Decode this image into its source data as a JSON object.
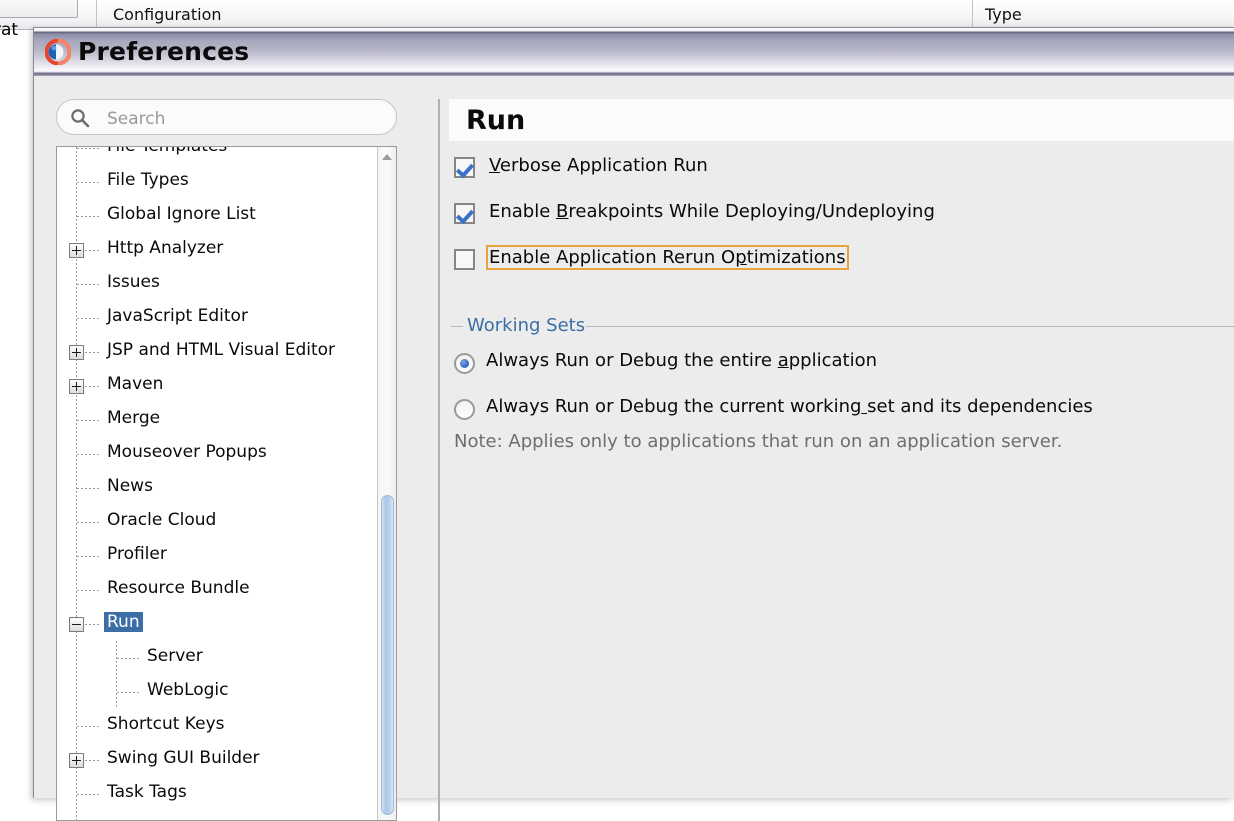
{
  "background_window": {
    "left_truncated_label": "rat",
    "columns": [
      "Configuration",
      "Type"
    ]
  },
  "dialog": {
    "title": "Preferences",
    "icon": "jdeveloper-logo-icon"
  },
  "search": {
    "placeholder": "Search",
    "value": "",
    "icon": "search-icon"
  },
  "tree": {
    "items": [
      {
        "label": "File Templates",
        "indent": 0,
        "toggle": "none",
        "selected": false,
        "clipped_top": true
      },
      {
        "label": "File Types",
        "indent": 0,
        "toggle": "none",
        "selected": false
      },
      {
        "label": "Global Ignore List",
        "indent": 0,
        "toggle": "none",
        "selected": false
      },
      {
        "label": "Http Analyzer",
        "indent": 0,
        "toggle": "plus",
        "selected": false
      },
      {
        "label": "Issues",
        "indent": 0,
        "toggle": "none",
        "selected": false
      },
      {
        "label": "JavaScript Editor",
        "indent": 0,
        "toggle": "none",
        "selected": false
      },
      {
        "label": "JSP and HTML Visual Editor",
        "indent": 0,
        "toggle": "plus",
        "selected": false
      },
      {
        "label": "Maven",
        "indent": 0,
        "toggle": "plus",
        "selected": false
      },
      {
        "label": "Merge",
        "indent": 0,
        "toggle": "none",
        "selected": false
      },
      {
        "label": "Mouseover Popups",
        "indent": 0,
        "toggle": "none",
        "selected": false
      },
      {
        "label": "News",
        "indent": 0,
        "toggle": "none",
        "selected": false
      },
      {
        "label": "Oracle Cloud",
        "indent": 0,
        "toggle": "none",
        "selected": false
      },
      {
        "label": "Profiler",
        "indent": 0,
        "toggle": "none",
        "selected": false
      },
      {
        "label": "Resource Bundle",
        "indent": 0,
        "toggle": "none",
        "selected": false
      },
      {
        "label": "Run",
        "indent": 0,
        "toggle": "minus",
        "selected": true
      },
      {
        "label": "Server",
        "indent": 1,
        "toggle": "none",
        "selected": false
      },
      {
        "label": "WebLogic",
        "indent": 1,
        "toggle": "none",
        "selected": false
      },
      {
        "label": "Shortcut Keys",
        "indent": 0,
        "toggle": "none",
        "selected": false
      },
      {
        "label": "Swing GUI Builder",
        "indent": 0,
        "toggle": "plus",
        "selected": false
      },
      {
        "label": "Task Tags",
        "indent": 0,
        "toggle": "none",
        "selected": false,
        "clipped_bottom": true
      }
    ],
    "scrollbar": {
      "up_arrow_icon": "scroll-up-arrow-icon"
    }
  },
  "content": {
    "title": "Run",
    "checkboxes": [
      {
        "label": "Verbose Application Run",
        "mnemonic_index": 0,
        "checked": true,
        "focused": false
      },
      {
        "label": "Enable Breakpoints While Deploying/Undeploying",
        "mnemonic_index": 7,
        "checked": true,
        "focused": false
      },
      {
        "label": "Enable Application Rerun Optimizations",
        "mnemonic_index": 26,
        "checked": false,
        "focused": true
      }
    ],
    "group": {
      "title": "Working Sets",
      "radios": [
        {
          "label": "Always Run or Debug the entire application",
          "mnemonic_index": 31,
          "selected": true
        },
        {
          "label": "Always Run or Debug the current working set and its dependencies",
          "mnemonic_index": 39,
          "selected": false
        }
      ],
      "note": "Note: Applies only to applications that run on an application server."
    }
  },
  "colors": {
    "selection_blue": "#3a6ea5",
    "group_title_blue": "#3b6ea5",
    "focus_orange": "#e8a33d",
    "check_blue": "#3a72c8",
    "dialog_bg": "#ececec",
    "note_gray": "#6e6e6e"
  }
}
